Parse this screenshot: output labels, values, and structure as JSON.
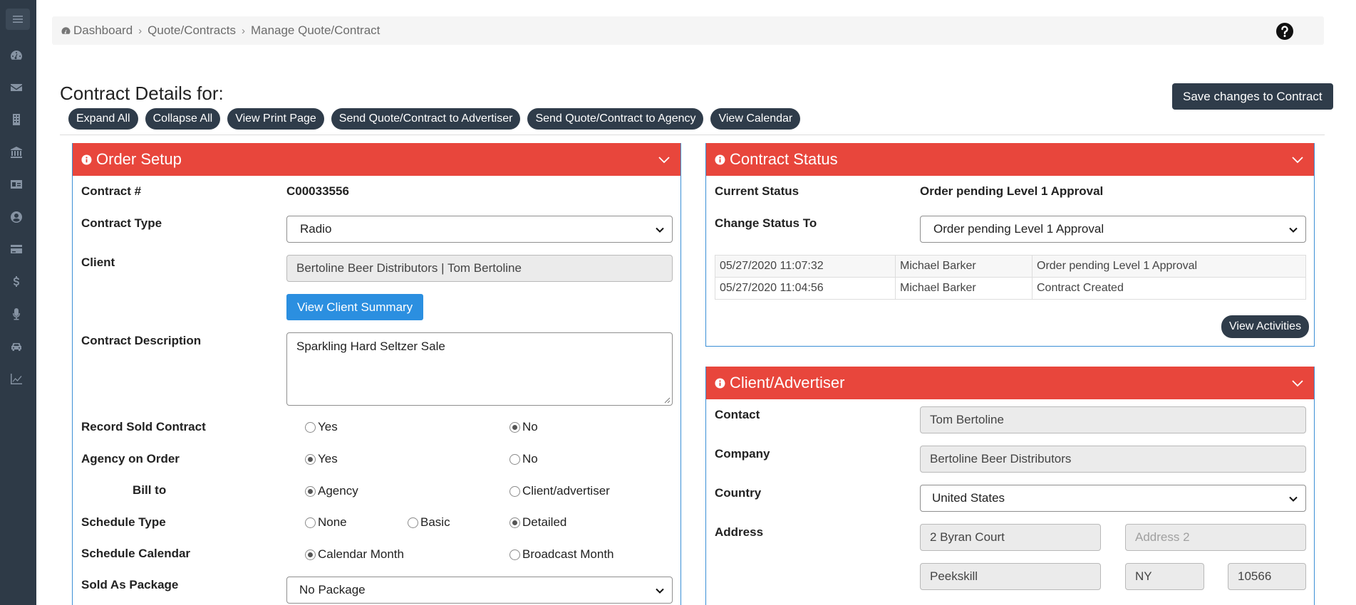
{
  "sidebar": {
    "icons": [
      "menu-icon",
      "dashboard-icon",
      "mail-icon",
      "building-icon",
      "bank-icon",
      "id-card-icon",
      "user-circle-icon",
      "credit-card-icon",
      "dollar-icon",
      "microphone-icon",
      "car-icon",
      "chart-line-icon"
    ]
  },
  "breadcrumb": {
    "items": [
      "Dashboard",
      "Quote/Contracts",
      "Manage Quote/Contract"
    ]
  },
  "header": {
    "title": "Contract Details for:",
    "save_label": "Save changes to Contract"
  },
  "actions": {
    "expand": "Expand All",
    "collapse": "Collapse All",
    "print": "View Print Page",
    "send_adv": "Send Quote/Contract to Advertiser",
    "send_agency": "Send Quote/Contract to Agency",
    "calendar": "View Calendar"
  },
  "order_setup": {
    "title": "Order Setup",
    "contract_no_label": "Contract #",
    "contract_no": "C00033556",
    "type_label": "Contract Type",
    "type_value": "Radio",
    "client_label": "Client",
    "client_value": "Bertoline Beer Distributors | Tom Bertoline",
    "client_summary_btn": "View Client Summary",
    "desc_label": "Contract Description",
    "desc_value": "Sparkling Hard Seltzer Sale",
    "record_sold_label": "Record Sold Contract",
    "agency_label": "Agency on Order",
    "bill_to_label": "Bill to",
    "schedule_type_label": "Schedule Type",
    "schedule_cal_label": "Schedule Calendar",
    "package_label": "Sold As Package",
    "package_value": "No Package",
    "opt_yes": "Yes",
    "opt_no": "No",
    "opt_agency": "Agency",
    "opt_client": "Client/advertiser",
    "opt_none": "None",
    "opt_basic": "Basic",
    "opt_detailed": "Detailed",
    "opt_cal_month": "Calendar Month",
    "opt_broadcast_month": "Broadcast Month"
  },
  "contract_status": {
    "title": "Contract Status",
    "current_label": "Current Status",
    "current_value": "Order pending Level 1 Approval",
    "change_label": "Change Status To",
    "change_value": "Order pending Level 1 Approval",
    "log": [
      {
        "time": "05/27/2020 11:07:32",
        "user": "Michael Barker",
        "action": "Order pending Level 1 Approval"
      },
      {
        "time": "05/27/2020 11:04:56",
        "user": "Michael Barker",
        "action": "Contract Created"
      }
    ],
    "activities_btn": "View Activities"
  },
  "client_advertiser": {
    "title": "Client/Advertiser",
    "contact_label": "Contact",
    "contact_value": "Tom Bertoline",
    "company_label": "Company",
    "company_value": "Bertoline Beer Distributors",
    "country_label": "Country",
    "country_value": "United States",
    "address_label": "Address",
    "address1": "2 Byran Court",
    "address2_placeholder": "Address 2",
    "city": "Peekskill",
    "state": "NY",
    "zip": "10566"
  },
  "colors": {
    "sidebar": "#2e3a47",
    "panel_header": "#e8463c",
    "dark_button": "#2f3c4a",
    "primary_button": "#2b8fe0",
    "panel_border": "#3b8fd6"
  }
}
